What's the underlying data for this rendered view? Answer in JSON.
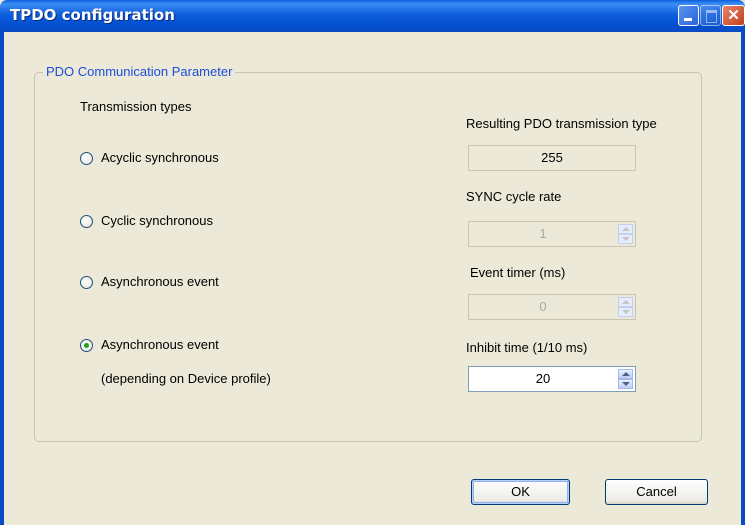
{
  "window": {
    "title": "TPDO configuration"
  },
  "group": {
    "legend": "PDO Communication Parameter"
  },
  "transmission_types": {
    "heading": "Transmission types",
    "options": [
      {
        "label": "Acyclic synchronous",
        "checked": false
      },
      {
        "label": "Cyclic synchronous",
        "checked": false
      },
      {
        "label": "Asynchronous event",
        "checked": false
      },
      {
        "label": "Asynchronous event",
        "sublabel": "(depending on Device profile)",
        "checked": true
      }
    ]
  },
  "resulting_type": {
    "label": "Resulting PDO transmission type",
    "value": "255"
  },
  "sync_cycle_rate": {
    "label": "SYNC cycle rate",
    "value": "1"
  },
  "event_timer": {
    "label": "Event timer (ms)",
    "value": "0"
  },
  "inhibit_time": {
    "label": "Inhibit time (1/10 ms)",
    "value": "20"
  },
  "buttons": {
    "ok": "OK",
    "cancel": "Cancel"
  },
  "colors": {
    "title_bar": "#0A5FDC",
    "legend_text": "#1C4ED8",
    "dialog_bg": "#ECE9D8",
    "radio_checked": "#21A121"
  }
}
